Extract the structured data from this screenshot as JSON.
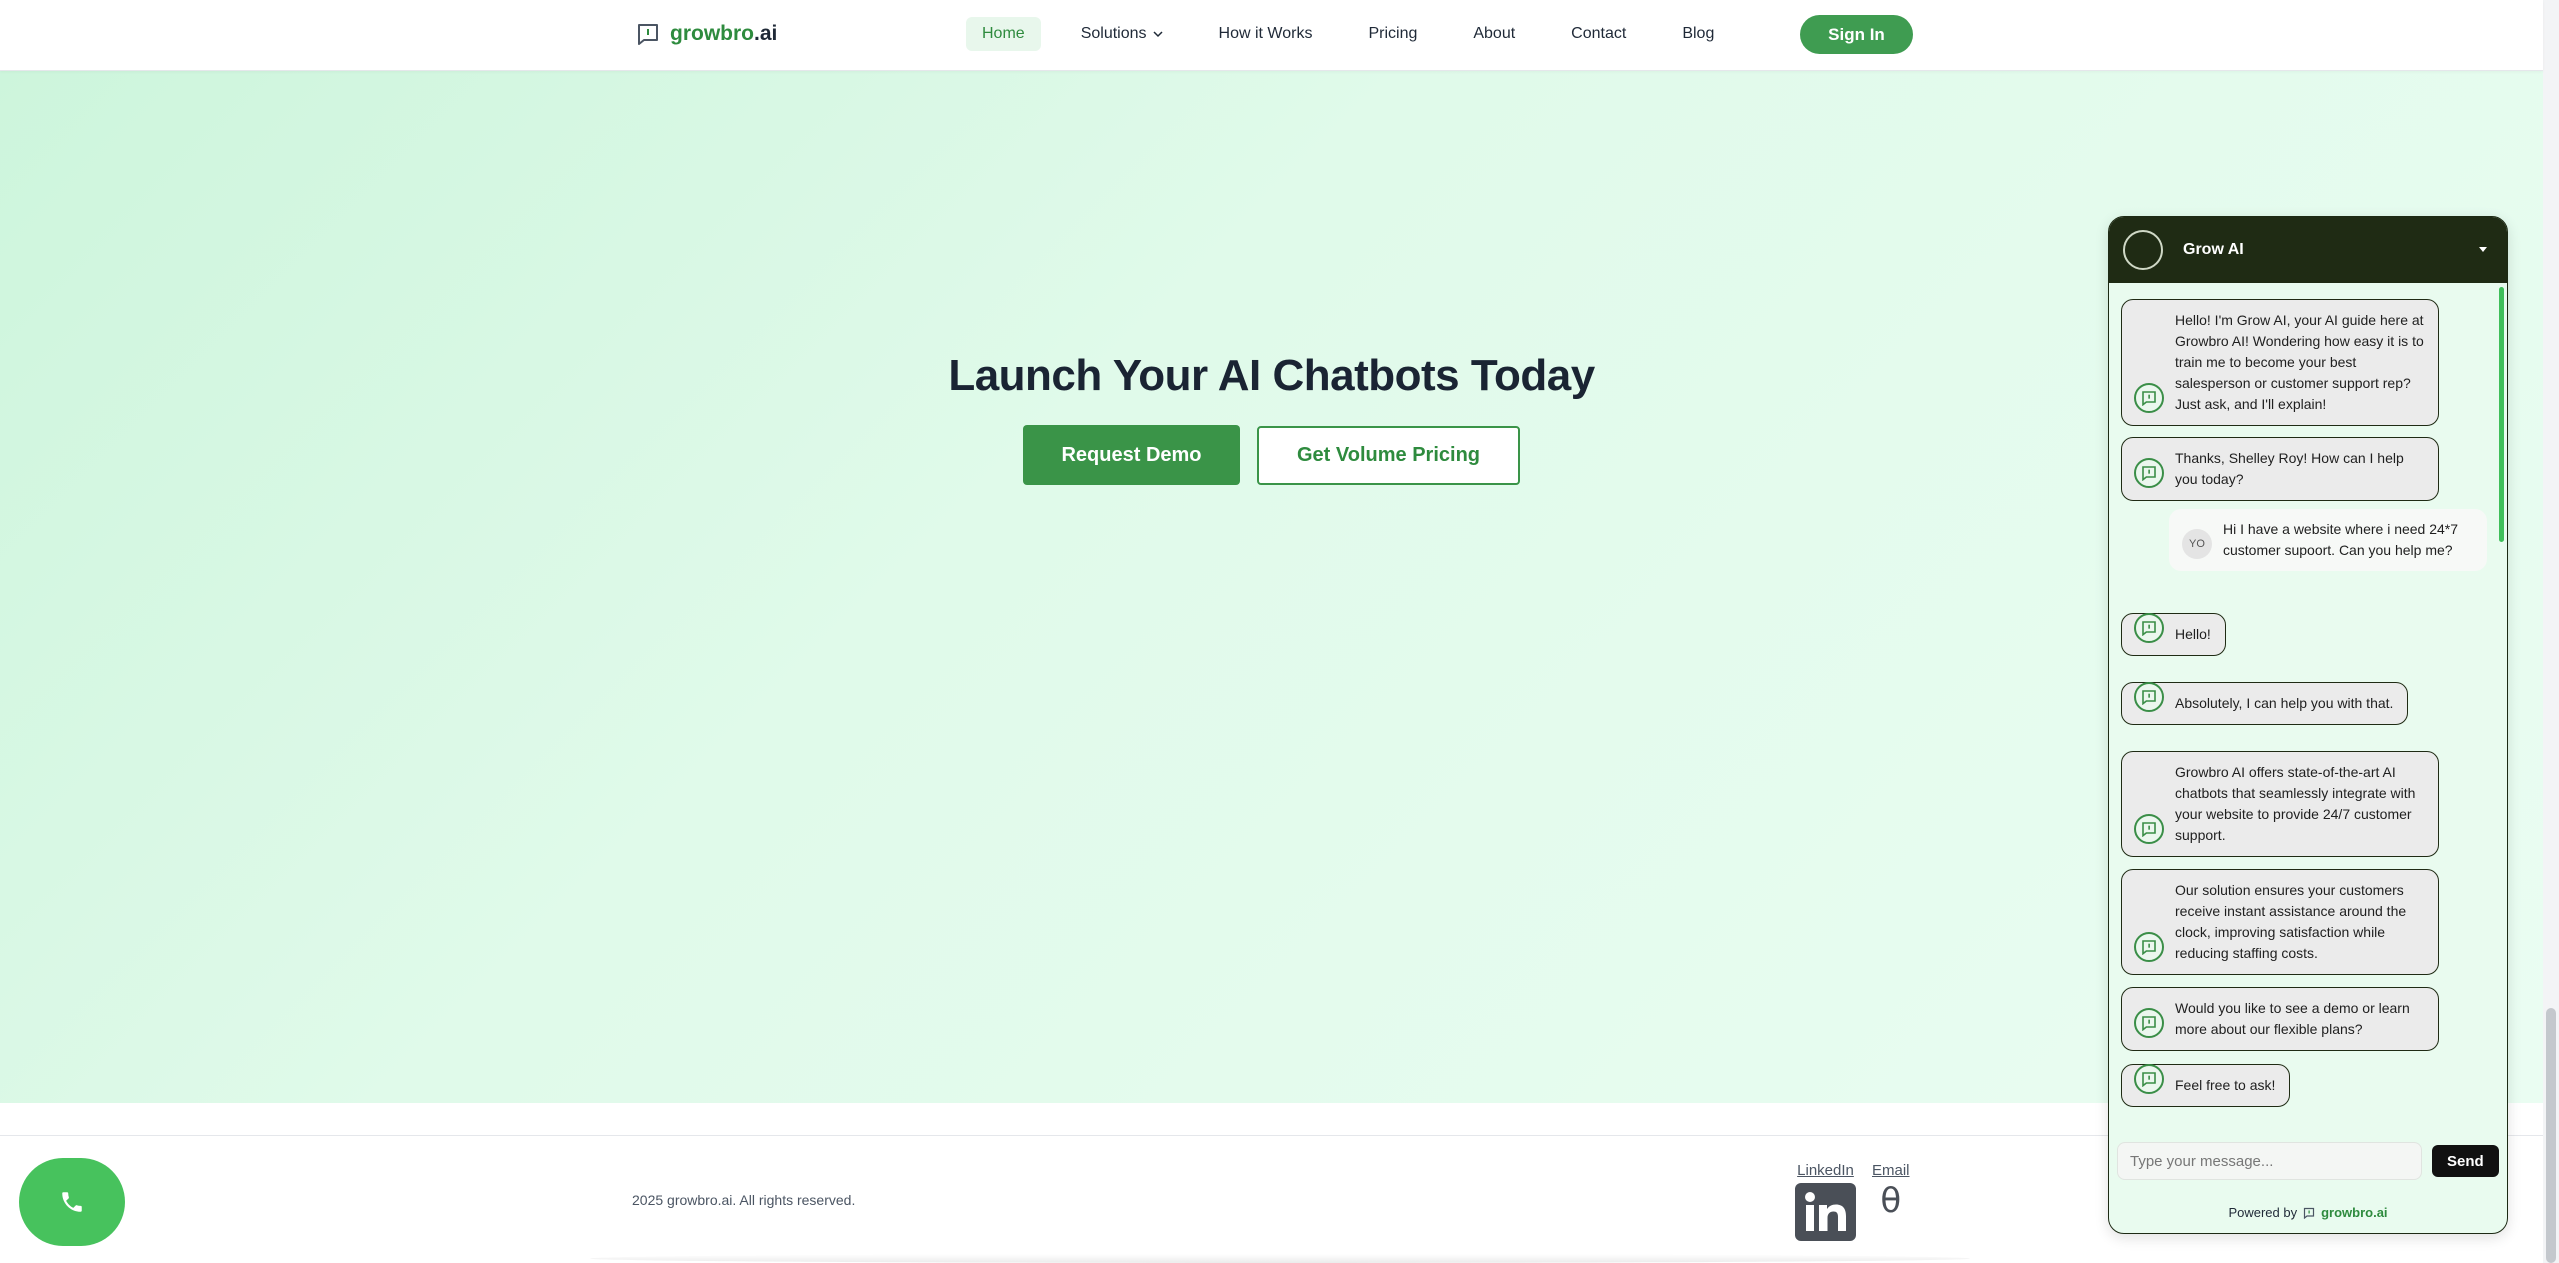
{
  "header": {
    "logo_brand": "growbro",
    "logo_suffix": ".ai",
    "nav": [
      {
        "label": "Home"
      },
      {
        "label": "Solutions"
      },
      {
        "label": "How it Works"
      },
      {
        "label": "Pricing"
      },
      {
        "label": "About"
      },
      {
        "label": "Contact"
      },
      {
        "label": "Blog"
      }
    ],
    "signin_label": "Sign In"
  },
  "hero": {
    "title": "Launch Your AI Chatbots Today",
    "demo_label": "Request Demo",
    "volume_label": "Get Volume Pricing"
  },
  "footer": {
    "copyright": "2025 growbro.ai. All rights reserved.",
    "linkedin_label": "LinkedIn",
    "email_label": "Email",
    "email_glyph": "θ"
  },
  "chat": {
    "title": "Grow AI",
    "user_initials": "YO",
    "messages": [
      {
        "from": "bot",
        "text": "Hello! I'm Grow AI, your AI guide here at Growbro AI! Wondering how easy it is to train me to become your best salesperson or customer support rep? Just ask, and I'll explain!"
      },
      {
        "from": "bot",
        "text": "Thanks, Shelley Roy! How can I help you today?"
      },
      {
        "from": "user",
        "text": "Hi I have a website where i need 24*7 customer supoort. Can you help me?"
      },
      {
        "from": "bot",
        "text": "Hello!"
      },
      {
        "from": "bot",
        "text": "Absolutely, I can help you with that."
      },
      {
        "from": "bot",
        "text": "Growbro AI offers state-of-the-art AI chatbots that seamlessly integrate with your website to provide 24/7 customer support."
      },
      {
        "from": "bot",
        "text": "Our solution ensures your customers receive instant assistance around the clock, improving satisfaction while reducing staffing costs."
      },
      {
        "from": "bot",
        "text": "Would you like to see a demo or learn more about our flexible plans?"
      },
      {
        "from": "bot",
        "text": "Feel free to ask!"
      }
    ],
    "input_placeholder": "Type your message...",
    "send_label": "Send",
    "powered_prefix": "Powered by",
    "powered_brand": "growbro.ai"
  },
  "colors": {
    "brand_green": "#2e8b3e",
    "button_green": "#3a9448",
    "chat_header": "#1f2b14",
    "hero_bg": "#d9f8e5"
  },
  "icons": {
    "logo": "chat-bubble-icon",
    "phone": "phone-icon",
    "linkedin": "linkedin-icon",
    "bot": "bot-chat-icon"
  }
}
